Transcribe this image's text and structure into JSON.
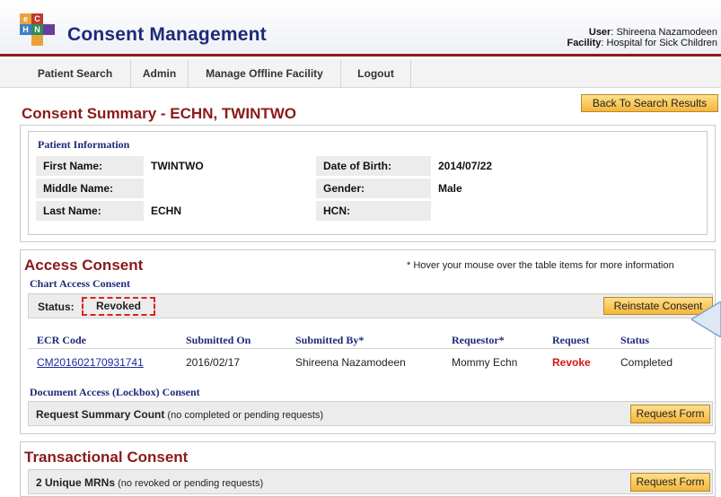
{
  "header": {
    "app_title": "Consent Management",
    "logo_letters": [
      "e",
      "C",
      "H",
      "N"
    ],
    "user_label": "User",
    "user_name": "Shireena Nazamodeen",
    "facility_label": "Facility",
    "facility_name": "Hospital for Sick Children"
  },
  "nav": {
    "items": [
      "Patient Search",
      "Admin",
      "Manage Offline Facility",
      "Logout"
    ]
  },
  "back_button": "Back To Search Results",
  "summary_title": "Consent Summary - ECHN, TWINTWO",
  "patient_info": {
    "heading": "Patient Information",
    "fields": {
      "first_name_label": "First Name:",
      "first_name": "TWINTWO",
      "middle_name_label": "Middle Name:",
      "middle_name": "",
      "last_name_label": "Last Name:",
      "last_name": "ECHN",
      "dob_label": "Date of Birth:",
      "dob": "2014/07/22",
      "gender_label": "Gender:",
      "gender": "Male",
      "hcn_label": "HCN:",
      "hcn": ""
    }
  },
  "access_consent": {
    "title": "Access Consent",
    "hint": "* Hover your mouse over the table items for more information",
    "chart_heading": "Chart Access Consent",
    "status_label": "Status:",
    "status_value": "Revoked",
    "reinstate_button": "Reinstate Consent",
    "columns": [
      "ECR Code",
      "Submitted On",
      "Submitted By*",
      "Requestor*",
      "Request",
      "Status"
    ],
    "rows": [
      {
        "ecr_code": "CM201602170931741",
        "submitted_on": "2016/02/17",
        "submitted_by": "Shireena Nazamodeen",
        "requestor": "Mommy Echn",
        "request": "Revoke",
        "status": "Completed"
      }
    ],
    "doc_heading": "Document Access (Lockbox) Consent",
    "doc_summary_bold": "Request Summary Count",
    "doc_summary_note": "(no completed or pending requests)",
    "doc_request_button": "Request Form"
  },
  "transactional_consent": {
    "title": "Transactional Consent",
    "summary_bold": "2 Unique MRNs",
    "summary_note": "(no revoked or pending requests)",
    "request_button": "Request Form"
  },
  "colors": {
    "brand_navy": "#1e2a78",
    "title_red": "#8b1a1a",
    "button_orange": "#f5b53c",
    "revoked_red": "#e02020"
  }
}
